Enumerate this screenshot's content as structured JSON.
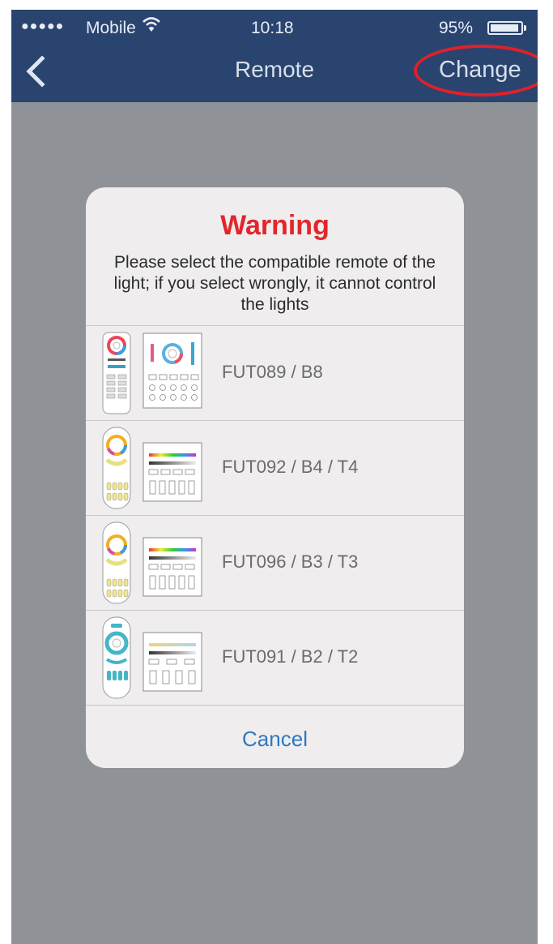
{
  "status_bar": {
    "signal": "●●●●●",
    "carrier": "Mobile",
    "time": "10:18",
    "battery": "95%",
    "battery_level": 0.95
  },
  "nav": {
    "back_icon": "chevron-left-icon",
    "title": "Remote",
    "change_label": "Change"
  },
  "dialog": {
    "title": "Warning",
    "message": "Please select the compatible remote of the light; if you select wrongly, it cannot control the lights",
    "options": [
      {
        "label": "FUT089 / B8"
      },
      {
        "label": "FUT092 / B4 / T4"
      },
      {
        "label": "FUT096 / B3 / T3"
      },
      {
        "label": "FUT091 / B2 / T2"
      }
    ],
    "cancel_label": "Cancel"
  },
  "colors": {
    "nav_bar": "#2a4470",
    "overlay": "#8f9296",
    "warning": "#e2262b",
    "cancel": "#2f78c0",
    "highlight_ring": "#e0202a"
  }
}
